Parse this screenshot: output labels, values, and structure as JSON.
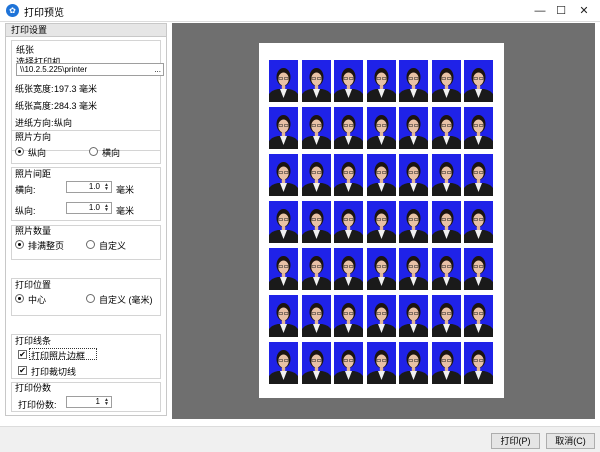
{
  "window": {
    "title": "打印预览",
    "app_icon": "app-logo-icon",
    "min_glyph": "—",
    "max_glyph": "☐",
    "close_glyph": "✕"
  },
  "settings": {
    "header": "打印设置",
    "paper": {
      "title": "纸张",
      "choose_printer": "选择打印机...",
      "printer_path": "\\\\10.2.5.225\\printer",
      "browse": "...",
      "width_label": "纸张宽度:",
      "width_value": "197.3 毫米",
      "height_label": "纸张高度:",
      "height_value": "284.3 毫米",
      "feed_label": "进纸方向:",
      "feed_value": "纵向"
    },
    "orientation": {
      "title": "照片方向",
      "portrait": "纵向",
      "landscape": "横向",
      "selected": "portrait"
    },
    "spacing": {
      "title": "照片间距",
      "horizontal_label": "横向:",
      "horizontal_value": "1.0",
      "vertical_label": "纵向:",
      "vertical_value": "1.0",
      "unit": "毫米"
    },
    "quantity": {
      "title": "照片数量",
      "fill_page": "排满整页",
      "custom": "自定义",
      "selected": "fill_page"
    },
    "position": {
      "title": "打印位置",
      "center": "中心",
      "custom": "自定义 (毫米)",
      "selected": "center"
    },
    "lines": {
      "title": "打印线条",
      "border": "打印照片边框",
      "border_checked": true,
      "cut_lines": "打印裁切线",
      "cut_checked": true,
      "check_glyph": "✔"
    },
    "copies": {
      "title": "打印份数",
      "label": "打印份数:",
      "value": "1"
    }
  },
  "preview": {
    "rows": 7,
    "cols": 7,
    "photo_background": "#1f22e8",
    "paper_color": "#ffffff",
    "canvas_color": "#6f6f6f"
  },
  "buttons": {
    "print": "打印(P)",
    "cancel": "取消(C)"
  }
}
